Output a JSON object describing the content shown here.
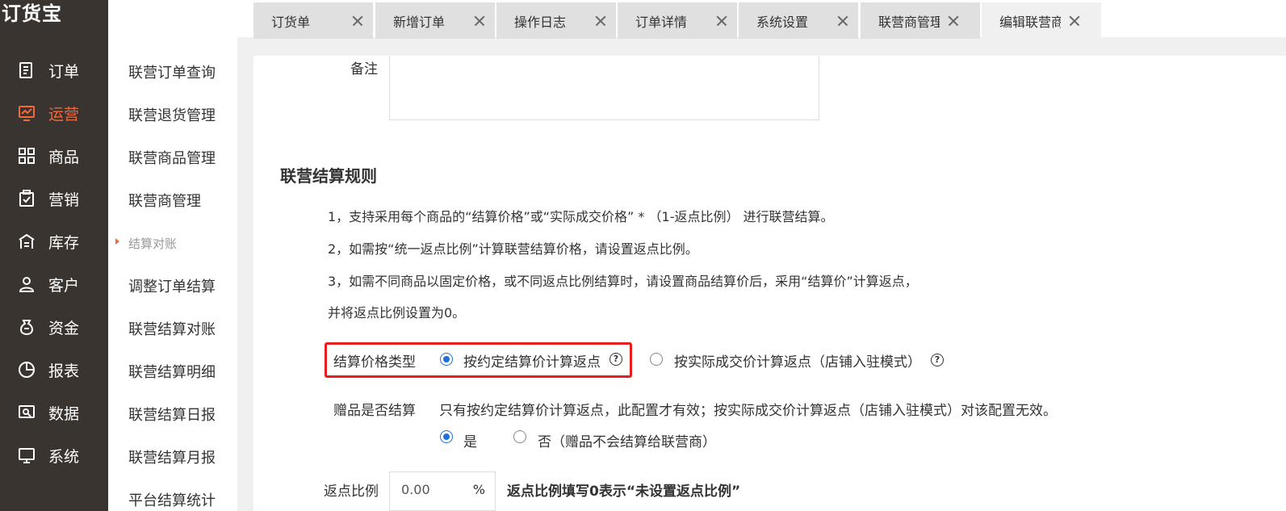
{
  "app": {
    "logo": "订货宝"
  },
  "nav": {
    "items": [
      {
        "label": "订单",
        "icon": "order-icon"
      },
      {
        "label": "运营",
        "icon": "operation-icon",
        "active": true
      },
      {
        "label": "商品",
        "icon": "goods-icon"
      },
      {
        "label": "营销",
        "icon": "marketing-icon"
      },
      {
        "label": "库存",
        "icon": "warehouse-icon"
      },
      {
        "label": "客户",
        "icon": "customer-icon"
      },
      {
        "label": "资金",
        "icon": "money-icon"
      },
      {
        "label": "报表",
        "icon": "report-icon"
      },
      {
        "label": "数据",
        "icon": "data-icon"
      },
      {
        "label": "系统",
        "icon": "system-icon"
      }
    ],
    "accent": "#f06a3c",
    "bg": "#3a3431"
  },
  "subnav": {
    "items": [
      "联营订单查询",
      "联营退货管理",
      "联营商品管理",
      "联营商管理"
    ],
    "section": "结算对账",
    "section_items": [
      "调整订单结算",
      "联营结算对账",
      "联营结算明细",
      "联营结算日报",
      "联营结算月报",
      "平台结算统计"
    ]
  },
  "tabs": [
    {
      "label": "订货单"
    },
    {
      "label": "新增订单"
    },
    {
      "label": "操作日志"
    },
    {
      "label": "订单详情"
    },
    {
      "label": "系统设置"
    },
    {
      "label": "联营商管理"
    },
    {
      "label": "编辑联营商",
      "active": true
    }
  ],
  "form": {
    "remark_label": "备注",
    "section_title": "联营结算规则",
    "rules": [
      "1，支持采用每个商品的“结算价格”或“实际成交价格” * （1-返点比例） 进行联营结算。",
      "2，如需按“统一返点比例”计算联营结算价格，请设置返点比例。",
      "3，如需不同商品以固定价格，或不同返点比例结算时，请设置商品结算价后，采用“结算价”计算返点，",
      "并将返点比例设置为0。"
    ],
    "price_type_label": "结算价格类型",
    "price_type_options": [
      {
        "label": "按约定结算价计算返点",
        "selected": true
      },
      {
        "label": "按实际成交价计算返点（店铺入驻模式）",
        "selected": false
      }
    ],
    "gift_label": "赠品是否结算",
    "gift_hint": "只有按约定结算价计算返点，此配置才有效；按实际成交价计算返点（店铺入驻模式）对该配置无效。",
    "gift_options": [
      {
        "label": "是",
        "selected": true
      },
      {
        "label": "否（赠品不会结算给联营商）",
        "selected": false
      }
    ],
    "rebate_label": "返点比例",
    "rebate_value": "0.00",
    "rebate_unit": "%",
    "rebate_note": "返点比例填写0表示“未设置返点比例”"
  },
  "colors": {
    "radio": "#1e6fd9",
    "highlight": "#e81e1e"
  }
}
